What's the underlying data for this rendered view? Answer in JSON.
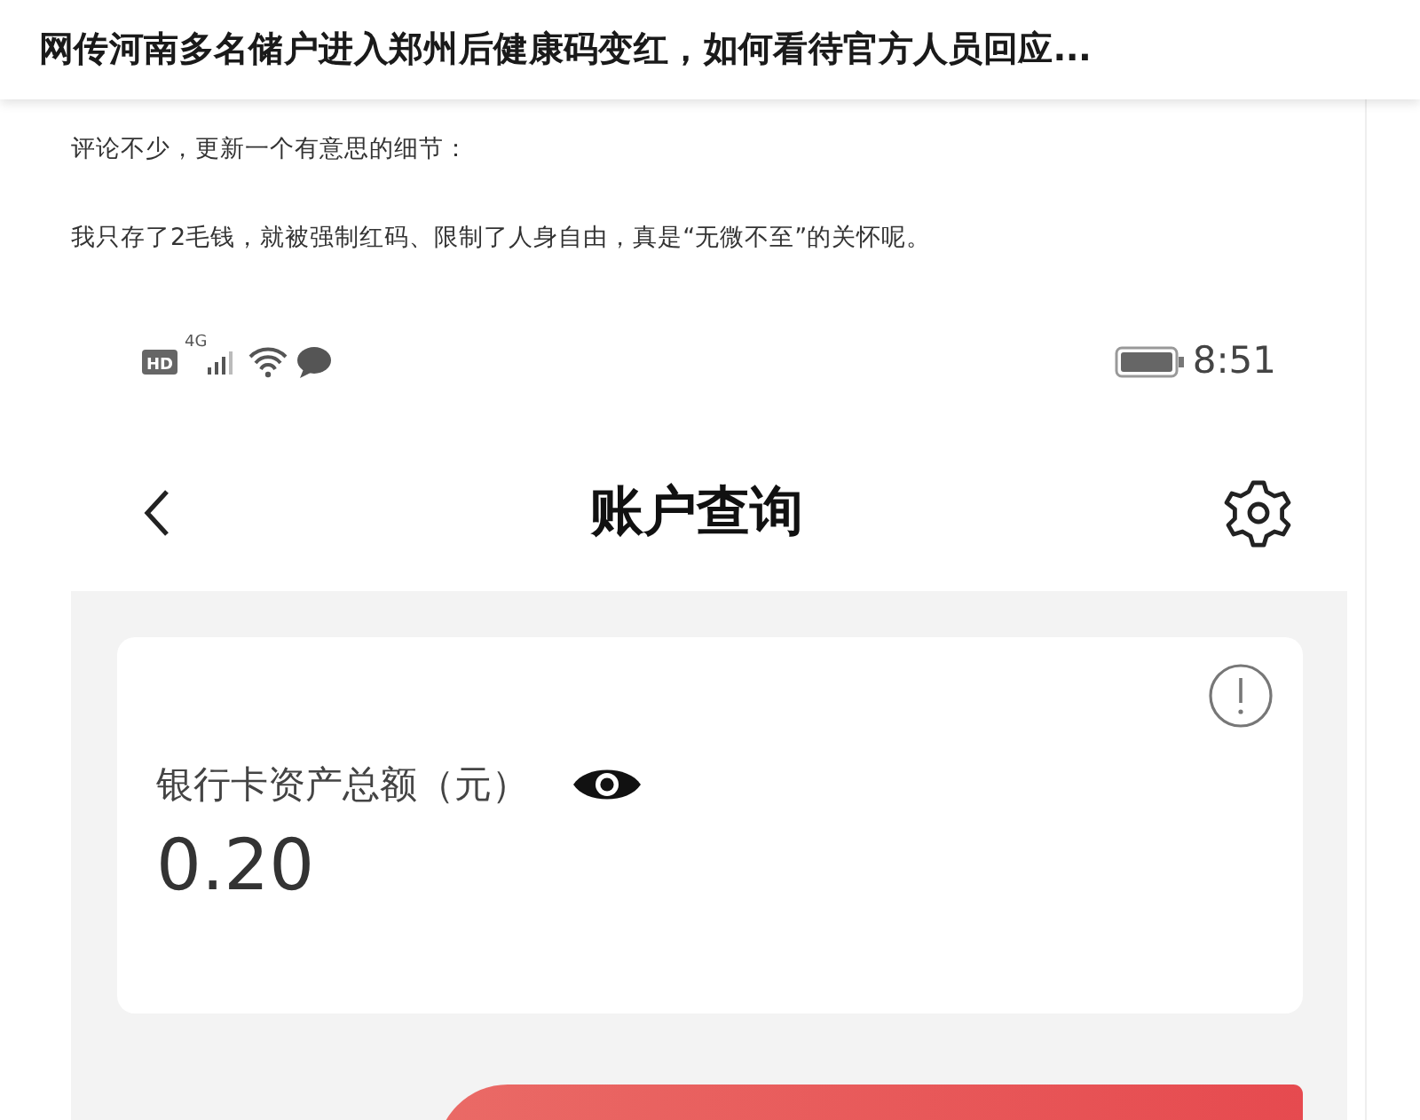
{
  "header": {
    "title": "网传河南多名储户进入郑州后健康码变红，如何看待官方人员回应..."
  },
  "answer": {
    "paragraphs": [
      "评论不少，更新一个有意思的细节：",
      "我只存了2毛钱，就被强制红码、限制了人身自由，真是“无微不至”的关怀呢。"
    ]
  },
  "screenshot": {
    "status_bar": {
      "hd": "HD",
      "network": "4G",
      "time": "8:51"
    },
    "page_title": "账户查询",
    "balance_card": {
      "label": "银行卡资产总额（元）",
      "amount": "0.20"
    }
  }
}
